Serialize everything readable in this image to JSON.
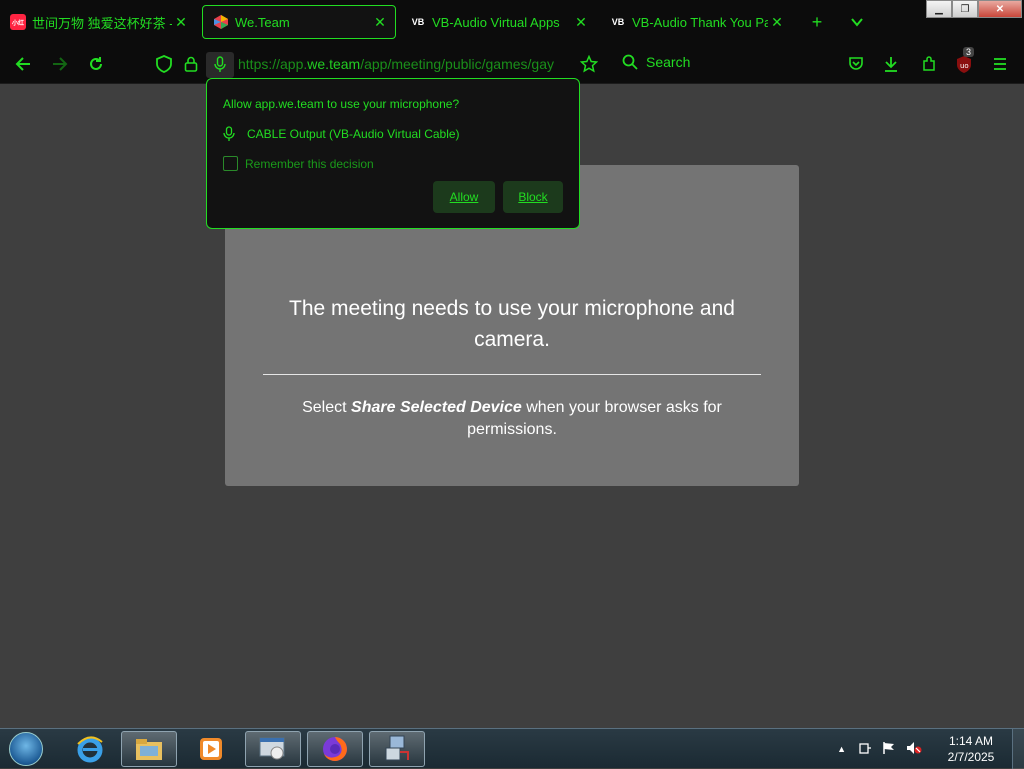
{
  "tabs": [
    {
      "title": "世间万物 独爱这杯好茶 - 小",
      "favicon": "red-app-icon",
      "active": false
    },
    {
      "title": "We.Team",
      "favicon": "we-team-icon",
      "active": true
    },
    {
      "title": "VB-Audio Virtual Apps",
      "favicon": "vb-audio-icon",
      "active": false
    },
    {
      "title": "VB-Audio Thank You Page",
      "favicon": "vb-audio-icon",
      "active": false
    }
  ],
  "favicon_text": {
    "red": "小红",
    "vb": "VB"
  },
  "navbar": {
    "url_prefix": "https://app.",
    "url_domain": "we.team",
    "url_rest": "/app/meeting/public/games/gay",
    "search_label": "Search",
    "notification_badge": "3"
  },
  "permission_popup": {
    "title": "Allow app.we.team to use your microphone?",
    "device": "CABLE Output (VB-Audio Virtual Cable)",
    "remember_label": "Remember this decision",
    "allow_label": "Allow",
    "block_label": "Block"
  },
  "meeting_card": {
    "heading": "The meeting needs to use your microphone and camera.",
    "instruction_prefix": "Select ",
    "instruction_bold": "Share Selected Device",
    "instruction_suffix": " when your browser asks for permissions."
  },
  "taskbar": {
    "time": "1:14 AM",
    "date": "2/7/2025"
  },
  "colors": {
    "accent": "#22dd22",
    "card": "#747474",
    "page_bg": "#3f3f3f"
  }
}
